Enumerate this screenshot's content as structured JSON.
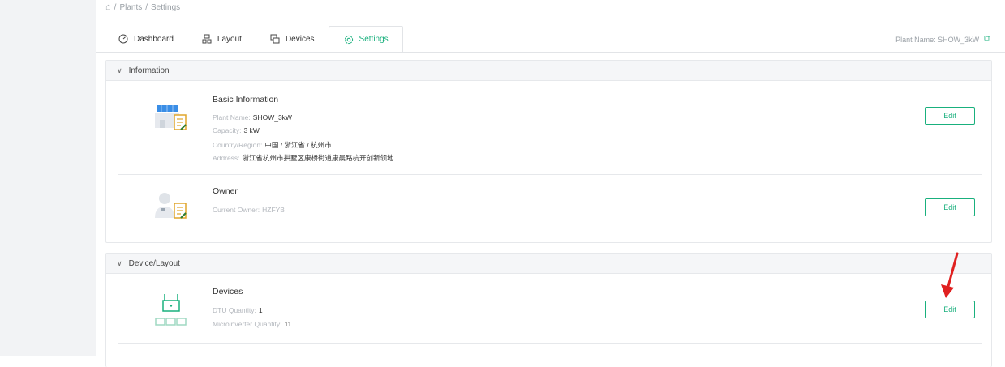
{
  "breadcrumb": {
    "home_icon": "home-icon",
    "separator": "/",
    "items": [
      "Plants",
      "Settings"
    ]
  },
  "tabs": [
    {
      "label": "Dashboard",
      "icon": "dashboard-icon",
      "active": false
    },
    {
      "label": "Layout",
      "icon": "layout-icon",
      "active": false
    },
    {
      "label": "Devices",
      "icon": "devices-icon",
      "active": false
    },
    {
      "label": "Settings",
      "icon": "settings-icon",
      "active": true
    }
  ],
  "plant_header": {
    "text": "Plant Name: SHOW_3kW",
    "icon": "external-link-icon"
  },
  "information": {
    "title": "Information",
    "basic": {
      "title": "Basic Information",
      "rows": [
        {
          "label": "Plant Name:",
          "value": "SHOW_3kW"
        },
        {
          "label": "Capacity:",
          "value": "3 kW"
        },
        {
          "label": "Country/Region:",
          "value": "中国 / 浙江省 / 杭州市"
        },
        {
          "label": "Address:",
          "value": "浙江省杭州市拱墅区康桥街道康晨路杭开创新领地"
        }
      ],
      "edit": "Edit"
    },
    "owner": {
      "title": "Owner",
      "rows": [
        {
          "label": "Current Owner:",
          "value": "HZFYB"
        }
      ],
      "edit": "Edit"
    }
  },
  "device_layout": {
    "title": "Device/Layout",
    "devices": {
      "title": "Devices",
      "rows": [
        {
          "label": "DTU Quantity:",
          "value": "1"
        },
        {
          "label": "Microinverter Quantity:",
          "value": "11"
        }
      ],
      "edit": "Edit"
    }
  },
  "colors": {
    "accent": "#19b07d",
    "annotation_arrow": "#e02020"
  }
}
